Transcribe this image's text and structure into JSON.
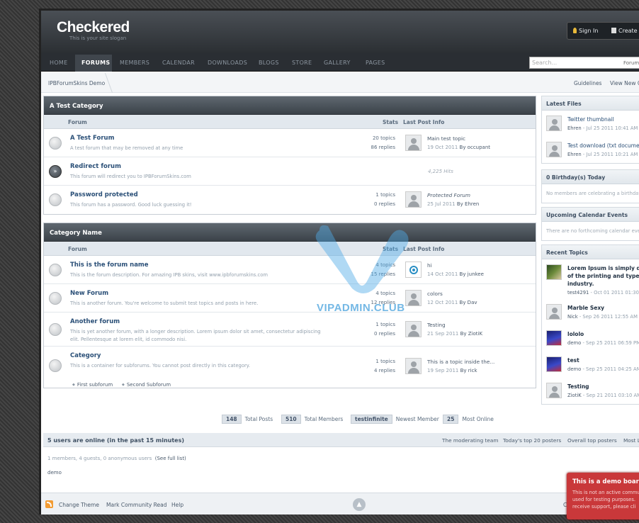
{
  "site": {
    "title": "Checkered",
    "slogan": "This is your site slogan"
  },
  "userbar": {
    "sign_in": "Sign In",
    "create": "Create"
  },
  "nav": {
    "items": [
      "HOME",
      "FORUMS",
      "MEMBERS",
      "CALENDAR",
      "DOWNLOADS",
      "BLOGS",
      "STORE",
      "GALLERY",
      "PAGES"
    ],
    "active": "FORUMS"
  },
  "search": {
    "placeholder": "Search...",
    "scope": "Forum"
  },
  "breadcrumb": {
    "home": "IPBForumSkins Demo",
    "guidelines": "Guidelines",
    "view_new": "View New Co"
  },
  "columns": {
    "forum": "Forum",
    "stats": "Stats",
    "last_post": "Last Post Info"
  },
  "categories": [
    {
      "name": "A Test Category",
      "forums": [
        {
          "title": "A Test Forum",
          "desc": "A test forum that may be removed at any time",
          "topics": "20 topics",
          "replies": "86 replies",
          "lp_title": "Main test topic",
          "lp_date": "19 Oct 2011",
          "lp_by": "By occupant"
        },
        {
          "title": "Redirect forum",
          "desc": "This forum will redirect you to IPBForumSkins.com",
          "hits": "4,225 Hits"
        },
        {
          "title": "Password protected",
          "desc": "This forum has a password. Good luck guessing it!",
          "topics": "1 topics",
          "replies": "0 replies",
          "lp_title": "Protected Forum",
          "lp_date": "25 Jul 2011",
          "lp_by": "By Ehren"
        }
      ]
    },
    {
      "name": "Category Name",
      "forums": [
        {
          "title": "This is the forum name",
          "desc": "This is the forum description. For amazing IPB skins, visit www.ipbforumskins.com",
          "topics": "4 topics",
          "replies": "15 replies",
          "lp_title": "hi",
          "lp_date": "14 Oct 2011",
          "lp_by": "By junkee"
        },
        {
          "title": "New Forum",
          "desc": "This is another forum. You're welcome to submit test topics and posts in here.",
          "topics": "4 topics",
          "replies": "12 replies",
          "lp_title": "colors",
          "lp_date": "12 Oct 2011",
          "lp_by": "By Dav"
        },
        {
          "title": "Another forum",
          "desc": "This is yet another forum, with a longer description. Lorem ipsum dolor sit amet, consectetur adipiscing",
          "desc2": "elit. Pellentesque at lorem elit, id commodo nisi.",
          "topics": "1 topics",
          "replies": "0 replies",
          "lp_title": "Testing",
          "lp_date": "21 Sep 2011",
          "lp_by": "By ZiotiK"
        },
        {
          "title": "Category",
          "desc": "This is a container for subforums. You cannot post directly in this category.",
          "topics": "1 topics",
          "replies": "4 replies",
          "lp_title": "This is a topic inside the...",
          "lp_date": "19 Sep 2011",
          "lp_by": "By rick",
          "sub1": "First subforum",
          "sub2": "Second Subforum"
        }
      ]
    }
  ],
  "stats": {
    "posts_count": "148",
    "posts_label": "Total Posts",
    "members_count": "510",
    "members_label": "Total Members",
    "newest": "testinfinite",
    "newest_label": "Newest Member",
    "online_count": "25",
    "online_label": "Most Online"
  },
  "online": {
    "title": "5 users are online (in the past 15 minutes)",
    "links": [
      "The moderating team",
      "Today's top 20 posters",
      "Overall top posters",
      "Most L"
    ],
    "summary": "1 members, 4 guests, 0 anonymous users",
    "full_list": "(See full list)",
    "user": "demo"
  },
  "footer": {
    "change_theme": "Change Theme",
    "mark_read": "Mark Community Read",
    "help": "Help",
    "right": "C"
  },
  "sidebar": {
    "latest_files": {
      "title": "Latest Files",
      "items": [
        {
          "title": "Twitter thumbnail",
          "author": "Ehren",
          "date": " - Jul 25 2011 10:41 AM"
        },
        {
          "title": "Test download (txt document)",
          "author": "Ehren",
          "date": " - Jul 25 2011 10:21 AM"
        }
      ]
    },
    "birthdays": {
      "title": "0 Birthday(s) Today",
      "empty": "No members are celebrating a birthday"
    },
    "calendar": {
      "title": "Upcoming Calendar Events",
      "empty": "There are no forthcoming calendar eve"
    },
    "recent": {
      "title": "Recent Topics",
      "items": [
        {
          "line1": "Lorem Ipsum is simply du",
          "line2": "of the printing and typese",
          "line3": "industry.",
          "author": "test4291",
          "date": " - Oct 01 2011 01:30"
        },
        {
          "line1": "Marble Sexy",
          "author": "Nick",
          "date": " - Sep 26 2011 12:55 AM"
        },
        {
          "line1": "lololo",
          "author": "demo",
          "date": " - Sep 25 2011 06:59 PM"
        },
        {
          "line1": "test",
          "author": "demo",
          "date": " - Sep 25 2011 04:25 AM"
        },
        {
          "line1": "Testing",
          "author": "ZiotiK",
          "date": " - Sep 21 2011 03:10 AM"
        }
      ]
    }
  },
  "demo_box": {
    "title": "This is a demo board",
    "line1": "This is not an active commu",
    "line2": "used for testing purposes.",
    "line3": "receive support, please cli"
  },
  "watermark": "VIPADMIN.CLUB"
}
